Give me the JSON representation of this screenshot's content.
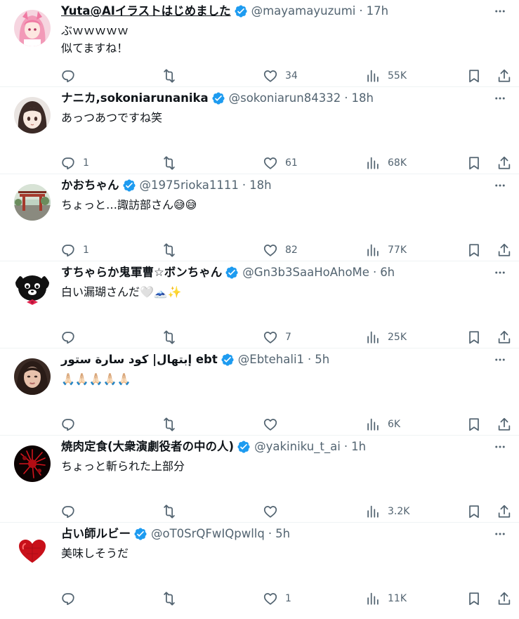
{
  "colors": {
    "text_primary": "#0f1419",
    "text_secondary": "#536471",
    "verified": "#1d9bf0",
    "divider": "#eff3f4"
  },
  "icons": {
    "reply": "reply-icon",
    "repost": "repost-icon",
    "like": "heart-icon",
    "views": "views-icon",
    "bookmark": "bookmark-icon",
    "share": "share-icon",
    "more": "more-icon",
    "verified": "verified-badge-icon"
  },
  "posts": [
    {
      "name": "Yuta@AIイラストはじめました",
      "handle": "@mayamayuzumi",
      "separator": "·",
      "time": "17h",
      "text": "ぶｗｗｗｗｗ\n似てますね！",
      "reply_count": "",
      "repost_count": "",
      "like_count": "34",
      "view_count": "55K",
      "avatar_icon": "anime-girl-avatar"
    },
    {
      "name": "ナニカ,sokoniarunanika",
      "handle": "@sokoniarun84332",
      "separator": "·",
      "time": "18h",
      "text": "あっつあつですね笑",
      "reply_count": "1",
      "repost_count": "",
      "like_count": "61",
      "view_count": "68K",
      "avatar_icon": "anime-face-avatar"
    },
    {
      "name": "かおちゃん",
      "handle": "@1975rioka1111",
      "separator": "·",
      "time": "18h",
      "text": "ちょっと…諏訪部さん😅😅",
      "reply_count": "1",
      "repost_count": "",
      "like_count": "82",
      "view_count": "77K",
      "avatar_icon": "shrine-photo-avatar"
    },
    {
      "name": "すちゃらか鬼軍曹☆ボンちゃん",
      "handle": "@Gn3b3SaaHoAhoMe",
      "separator": "·",
      "time": "6h",
      "text": "白い漏瑚さんだ🤍🗻✨",
      "reply_count": "",
      "repost_count": "",
      "like_count": "7",
      "view_count": "25K",
      "avatar_icon": "black-dog-avatar"
    },
    {
      "name": "إبتهال| كود سارة ستور ebt",
      "handle": "@Ebtehali1",
      "separator": "·",
      "time": "5h",
      "text": "🙏🏻🙏🏻🙏🏻🙏🏻🙏🏻",
      "reply_count": "",
      "repost_count": "",
      "like_count": "",
      "view_count": "6K",
      "avatar_icon": "woman-portrait-avatar"
    },
    {
      "name": "焼肉定食(大衆演劇役者の中の人)",
      "handle": "@yakiniku_t_ai",
      "separator": "·",
      "time": "1h",
      "text": "ちょっと斬られた上部分",
      "reply_count": "",
      "repost_count": "",
      "like_count": "",
      "view_count": "3.2K",
      "avatar_icon": "red-flower-avatar"
    },
    {
      "name": "占い師ルビー",
      "handle": "@oT0SrQFwIQpwllq",
      "separator": "·",
      "time": "5h",
      "text": "美味しそうだ",
      "reply_count": "",
      "repost_count": "",
      "like_count": "1",
      "view_count": "11K",
      "avatar_icon": "red-heart-avatar"
    }
  ]
}
